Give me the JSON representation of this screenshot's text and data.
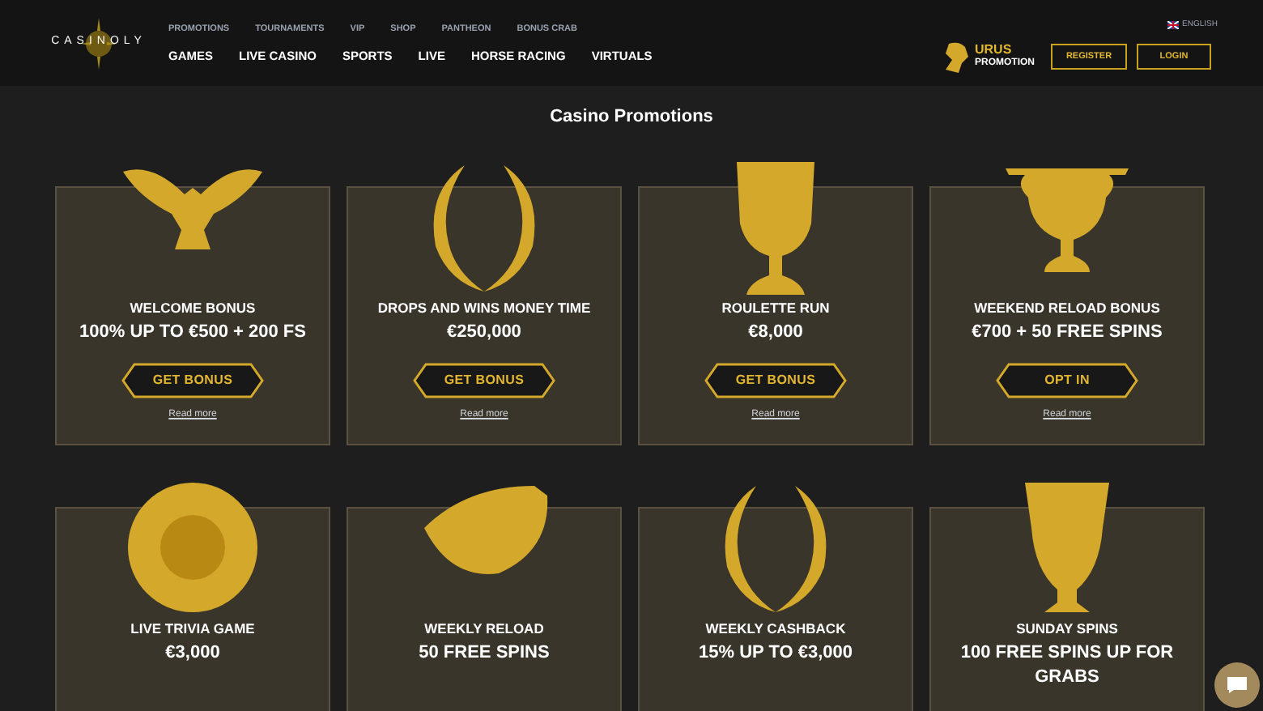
{
  "header": {
    "logo": "CASINOLY",
    "top_links": [
      "PROMOTIONS",
      "TOURNAMENTS",
      "VIP",
      "SHOP",
      "PANTHEON",
      "BONUS CRAB"
    ],
    "main_nav": [
      "GAMES",
      "LIVE CASINO",
      "SPORTS",
      "LIVE",
      "HORSE RACING",
      "VIRTUALS"
    ],
    "language": "ENGLISH",
    "promo_title": "URUS",
    "promo_subtitle": "PROMOTION",
    "register": "REGISTER",
    "login": "LOGIN"
  },
  "page_title": "Casino Promotions",
  "promotions": [
    {
      "kind": "eagle",
      "title": "WELCOME BONUS",
      "value": "100% UP TO €500 + 200 FS",
      "button": "GET BONUS",
      "link": "Read more"
    },
    {
      "kind": "wreath",
      "title": "DROPS AND WINS MONEY TIME",
      "value": "€250,000",
      "button": "GET BONUS",
      "link": "Read more"
    },
    {
      "kind": "goblet",
      "title": "ROULETTE RUN",
      "value": "€8,000",
      "button": "GET BONUS",
      "link": "Read more"
    },
    {
      "kind": "chalice",
      "title": "WEEKEND RELOAD BONUS",
      "value": "€700 + 50 FREE SPINS",
      "button": "OPT IN",
      "link": "Read more"
    },
    {
      "kind": "shield",
      "title": "LIVE TRIVIA GAME",
      "value": "€3,000"
    },
    {
      "kind": "bracelet",
      "title": "WEEKLY RELOAD",
      "value": "50 FREE SPINS"
    },
    {
      "kind": "wreath",
      "title": "WEEKLY CASHBACK",
      "value": "15% UP TO €3,000"
    },
    {
      "kind": "vase",
      "title": "SUNDAY SPINS",
      "value": "100 FREE SPINS UP FOR GRABS"
    }
  ]
}
